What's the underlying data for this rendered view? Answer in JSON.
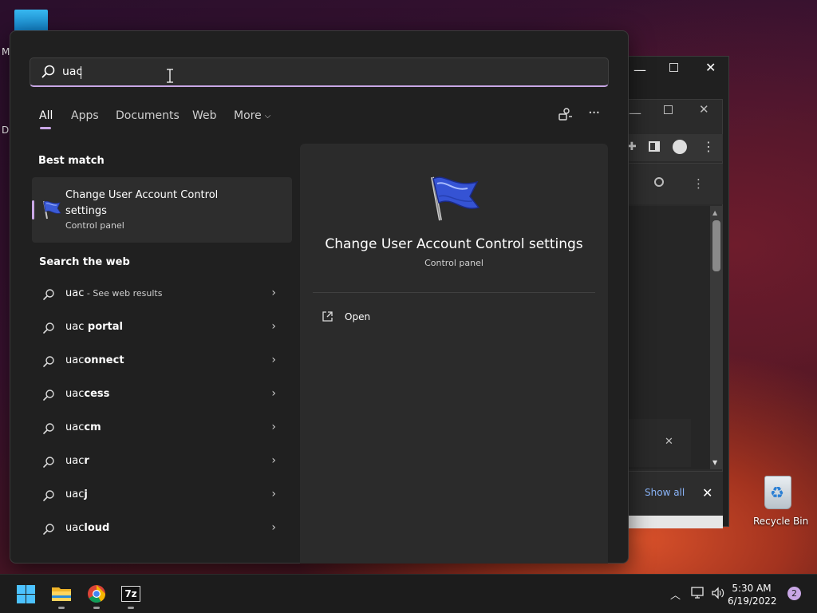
{
  "desktop": {
    "left_letters": [
      "M",
      "Da"
    ],
    "recycle_bin_label": "Recycle Bin"
  },
  "background_browser": {
    "show_all_label": "Show all"
  },
  "search": {
    "query": "uac",
    "tabs": [
      {
        "label": "All",
        "active": true
      },
      {
        "label": "Apps"
      },
      {
        "label": "Documents"
      },
      {
        "label": "Web"
      },
      {
        "label": "More"
      }
    ],
    "best_match_heading": "Best match",
    "best_match": {
      "title": "Change User Account Control settings",
      "subtitle": "Control panel",
      "icon": "uac-flag-icon"
    },
    "web_heading": "Search the web",
    "web_results": [
      {
        "prefix": "uac",
        "bold": "",
        "suffix": " - See web results"
      },
      {
        "prefix": "uac",
        "bold": " portal",
        "suffix": ""
      },
      {
        "prefix": "uac",
        "bold": "onnect",
        "suffix": ""
      },
      {
        "prefix": "uac",
        "bold": "cess",
        "suffix": ""
      },
      {
        "prefix": "uac",
        "bold": "cm",
        "suffix": ""
      },
      {
        "prefix": "uac",
        "bold": "r",
        "suffix": ""
      },
      {
        "prefix": "uac",
        "bold": "j",
        "suffix": ""
      },
      {
        "prefix": "uac",
        "bold": "loud",
        "suffix": ""
      }
    ],
    "preview": {
      "title": "Change User Account Control settings",
      "subtitle": "Control panel",
      "actions": [
        {
          "label": "Open",
          "icon": "open-external-icon"
        }
      ]
    }
  },
  "taskbar": {
    "time": "5:30 AM",
    "date": "6/19/2022",
    "notification_count": "2",
    "apps": [
      "start-icon",
      "file-explorer-icon",
      "chrome-icon",
      "7zip-icon"
    ],
    "seven_zip_label": "7z"
  },
  "colors": {
    "accent": "#c9a7e6",
    "flyout_bg": "#202020",
    "preview_bg": "#2b2b2b",
    "link": "#8ab4f8"
  }
}
